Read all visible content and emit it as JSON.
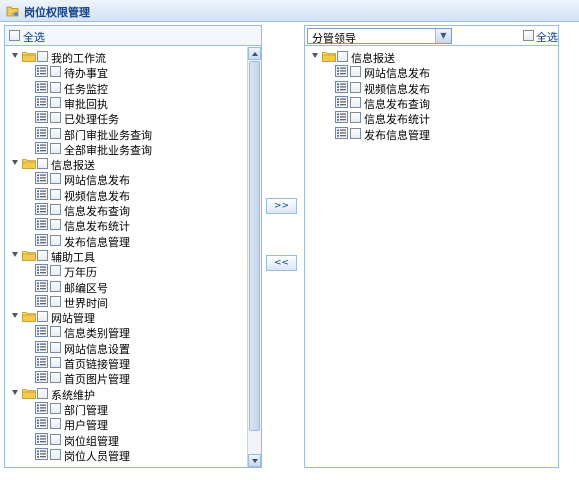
{
  "title": "岗位权限管理",
  "left": {
    "select_all": "全选",
    "tree": [
      {
        "label": "我的工作流",
        "children": [
          "待办事宜",
          "任务监控",
          "审批回执",
          "已处理任务",
          "部门审批业务查询",
          "全部审批业务查询"
        ]
      },
      {
        "label": "信息报送",
        "children": [
          "网站信息发布",
          "视频信息发布",
          "信息发布查询",
          "信息发布统计",
          "发布信息管理"
        ]
      },
      {
        "label": "辅助工具",
        "children": [
          "万年历",
          "邮编区号",
          "世界时间"
        ]
      },
      {
        "label": "网站管理",
        "children": [
          "信息类别管理",
          "网站信息设置",
          "首页链接管理",
          "首页图片管理"
        ]
      },
      {
        "label": "系统维护",
        "children": [
          "部门管理",
          "用户管理",
          "岗位组管理",
          "岗位人员管理"
        ]
      }
    ]
  },
  "buttons": {
    "add": ">>",
    "remove": "<<"
  },
  "right": {
    "role_select": "分管领导",
    "select_all": "全选",
    "tree": [
      {
        "label": "信息报送",
        "children": [
          "网站信息发布",
          "视频信息发布",
          "信息发布查询",
          "信息发布统计",
          "发布信息管理"
        ]
      }
    ]
  },
  "icons": {
    "title": "folder-key-icon",
    "group": "folder-icon",
    "leaf": "page-icon",
    "expand": "triangle-down-icon"
  },
  "colors": {
    "accent": "#15428b",
    "border": "#99bbe8",
    "folder": "#f0c54a"
  }
}
